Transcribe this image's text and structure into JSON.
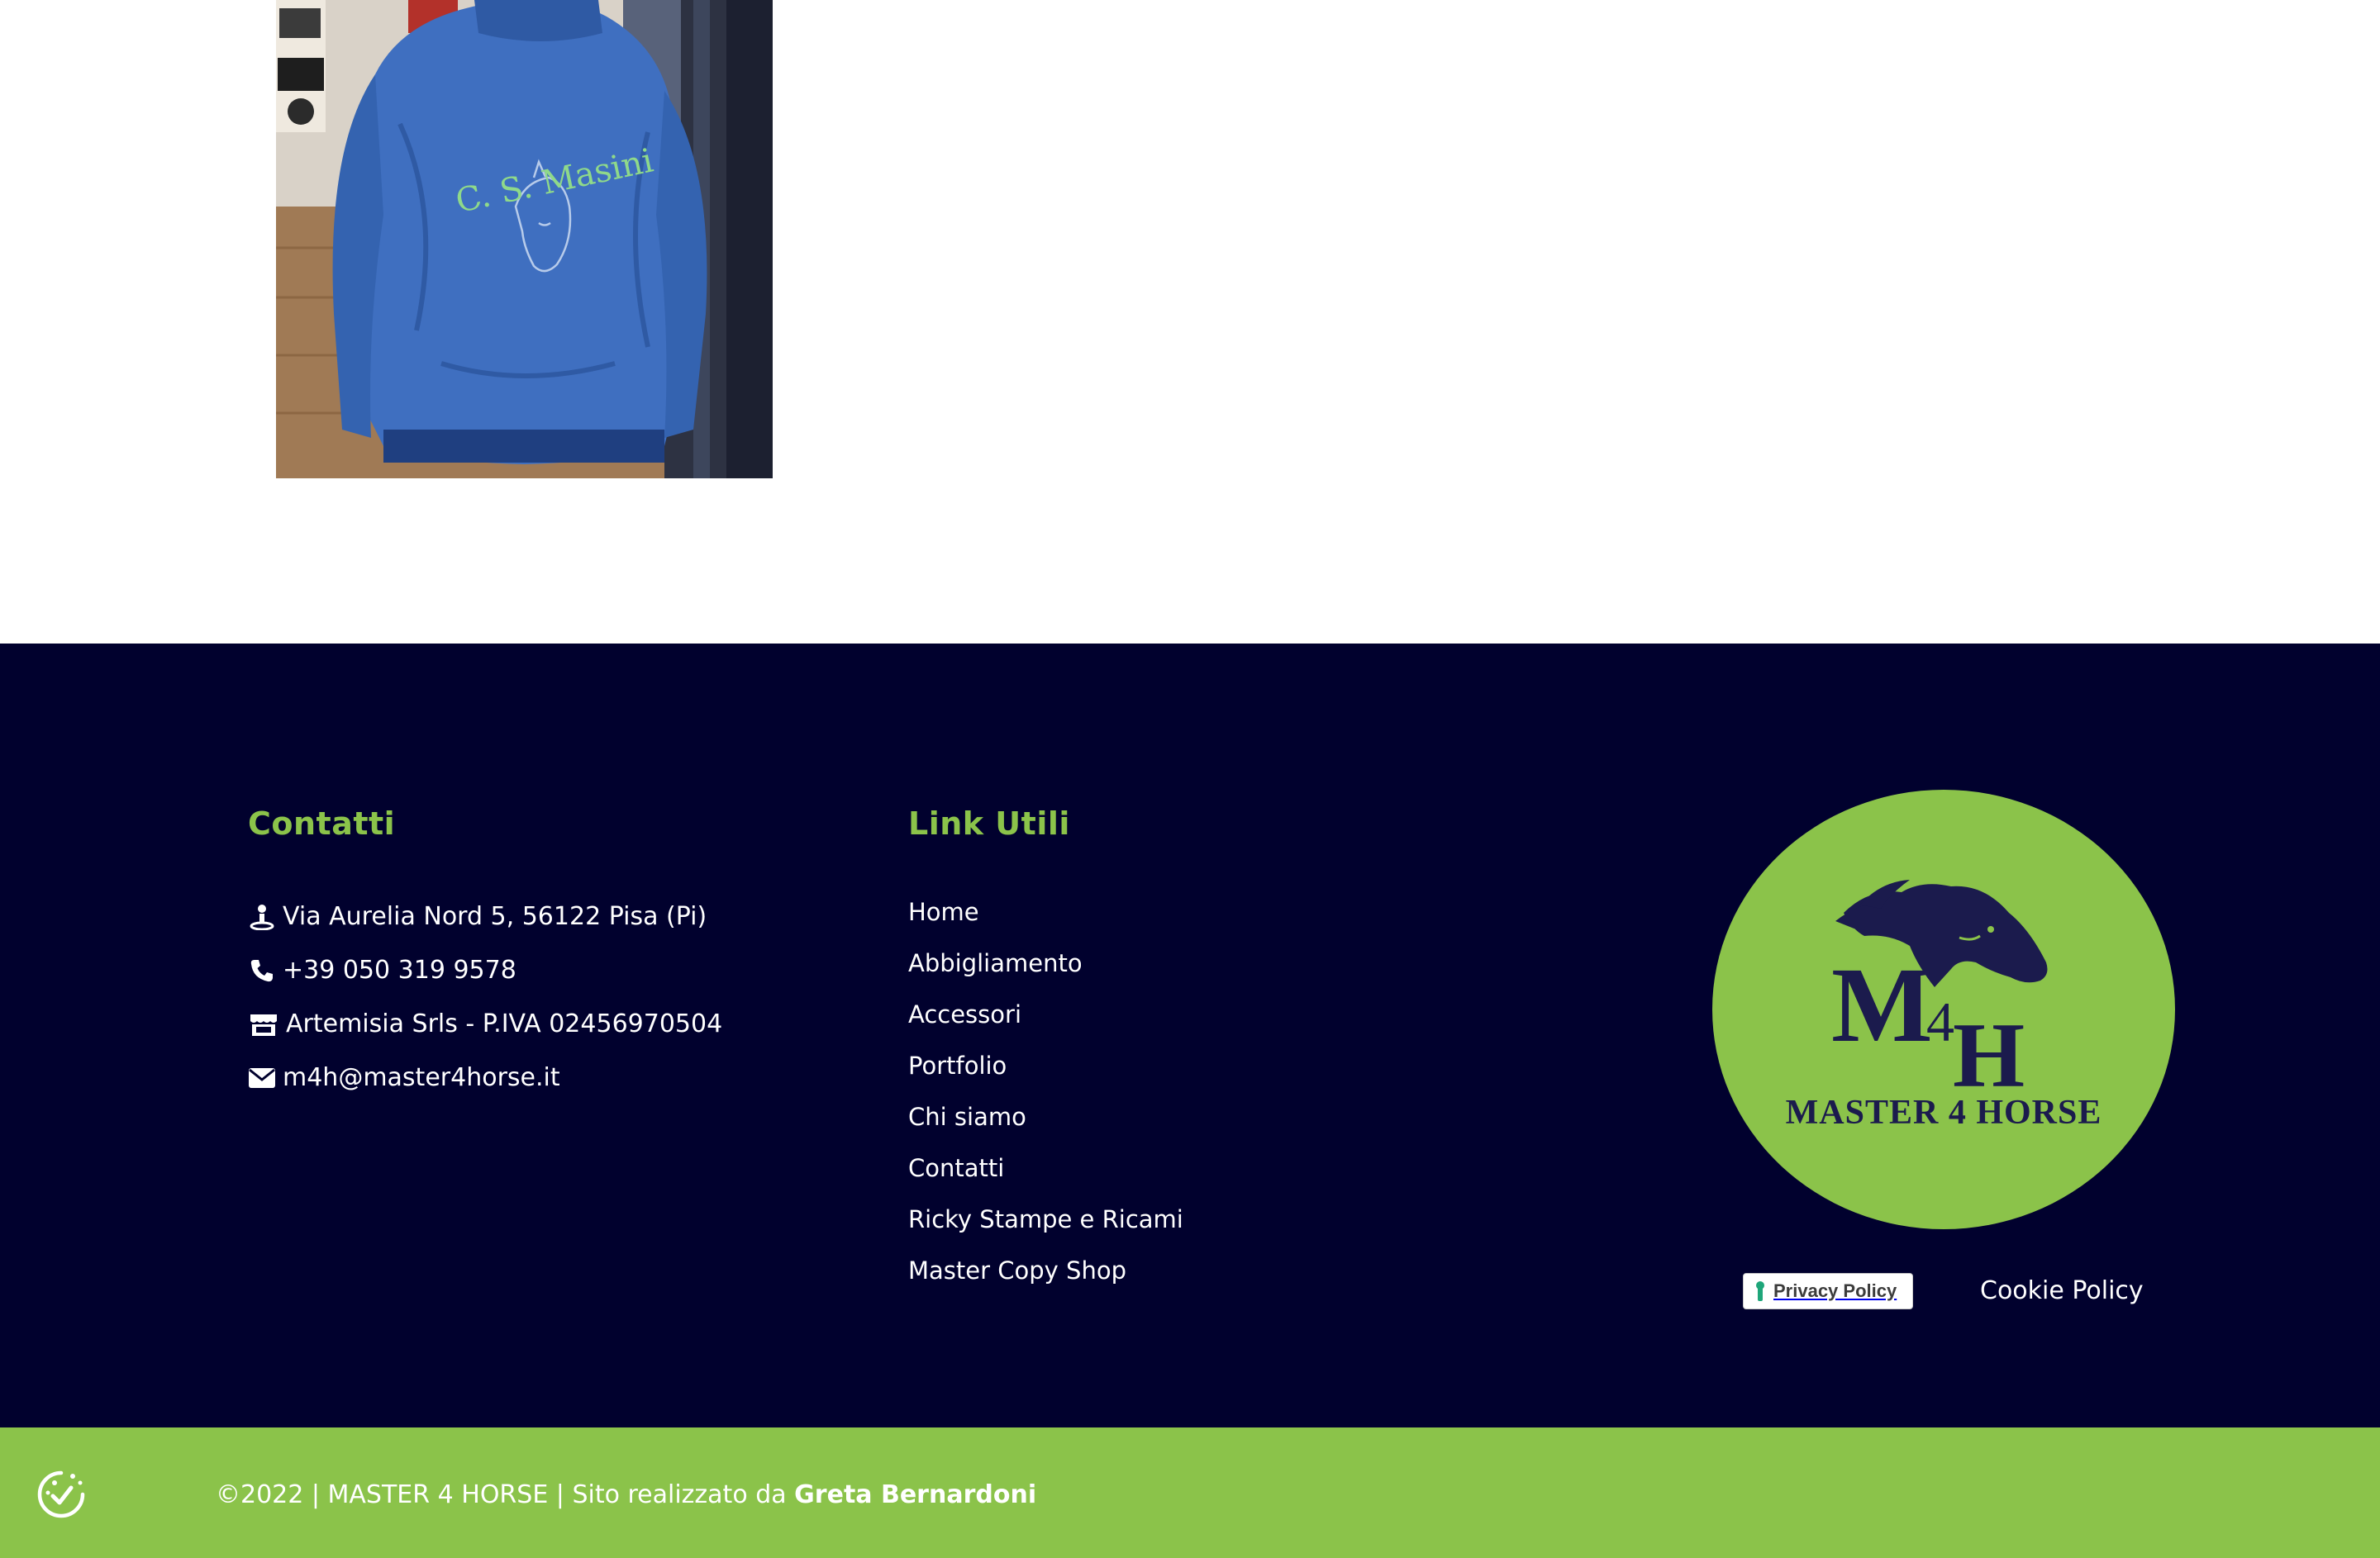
{
  "photo": {
    "embroidery_text": "C. S. Masini",
    "alt_icon": "jacket-photo"
  },
  "footer": {
    "contacts": {
      "title": "Contatti",
      "items": [
        {
          "icon": "location-pin-icon",
          "text": "Via Aurelia Nord 5, 56122 Pisa (Pi)"
        },
        {
          "icon": "phone-icon",
          "text": "+39 050 319 9578"
        },
        {
          "icon": "store-icon",
          "text": "Artemisia Srls - P.IVA 02456970504"
        },
        {
          "icon": "envelope-icon",
          "text": "m4h@master4horse.it"
        }
      ]
    },
    "links": {
      "title": "Link Utili",
      "items": [
        "Home",
        "Abbigliamento",
        "Accessori",
        "Portfolio",
        "Chi siamo",
        "Contatti",
        "Ricky Stampe e Ricami",
        "Master Copy Shop"
      ]
    },
    "logo": {
      "mark": "M4H",
      "m": "M",
      "four": "4",
      "h": "H",
      "tagline": "MASTER 4 HORSE"
    },
    "privacy_badge": "Privacy Policy",
    "cookie_policy": "Cookie Policy"
  },
  "bottom_bar": {
    "copyright_prefix": "©2022 | MASTER 4 HORSE | Sito realizzato da ",
    "author": "Greta Bernardoni"
  },
  "colors": {
    "footer_bg": "#01012e",
    "accent_green": "#8bc34a",
    "logo_navy": "#1b1b4d",
    "text_white": "#ffffff"
  }
}
